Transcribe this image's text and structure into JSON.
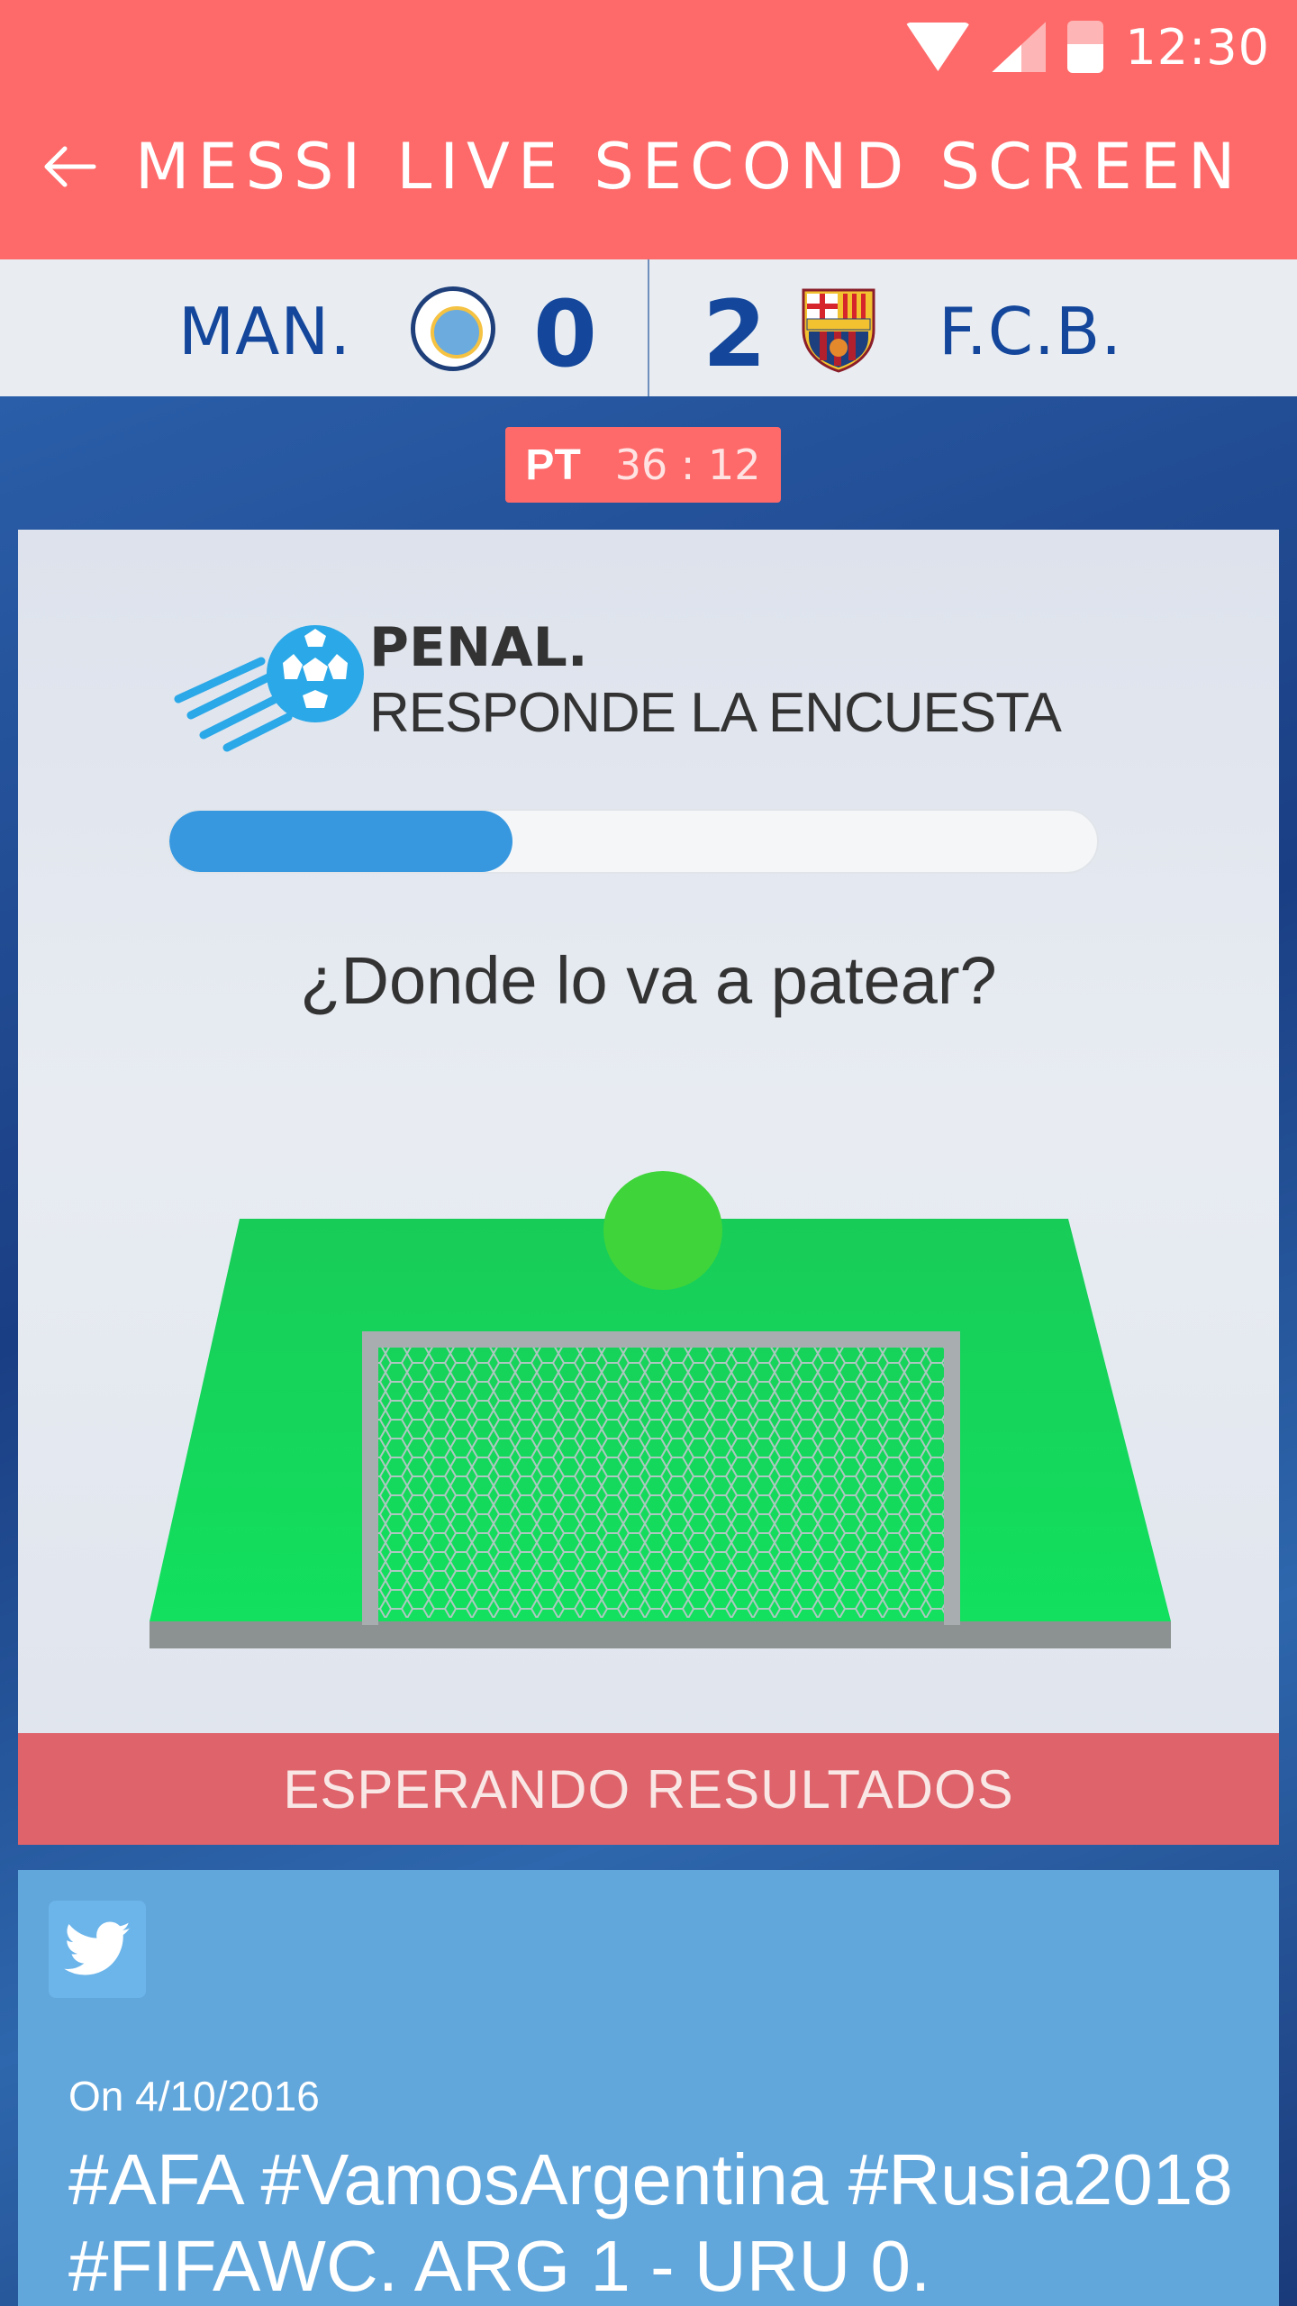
{
  "status_bar": {
    "time": "12:30",
    "icons": [
      "wifi-icon",
      "cell-signal-icon",
      "battery-icon"
    ]
  },
  "app_bar": {
    "title": "MESSI LIVE SECOND SCREEN",
    "back_icon": "arrow-back-icon"
  },
  "scoreboard": {
    "home": {
      "name": "MAN.",
      "score": "0",
      "crest": "man-city-crest"
    },
    "away": {
      "name": "F.C.B.",
      "score": "2",
      "crest": "fcb-crest"
    }
  },
  "timer": {
    "half": "PT",
    "clock": "36 : 12"
  },
  "poll": {
    "title": "PENAL.",
    "subtitle": "RESPONDE LA ENCUESTA",
    "progress": 0.37,
    "question": "¿Donde lo va a patear?",
    "status": "ESPERANDO RESULTADOS"
  },
  "tweet": {
    "icon": "twitter-icon",
    "date": "On 4/10/2016",
    "text": "#AFA #VamosArgentina #Rusia2018 #FIFAWC. ARG 1 - URU 0."
  },
  "colors": {
    "accent": "#fe6a6a",
    "team_blue": "#14479b",
    "progress": "#3798e0",
    "tweet_bg": "#62a7dc",
    "pitch": "#16cf55",
    "target": "#3fd43a"
  }
}
